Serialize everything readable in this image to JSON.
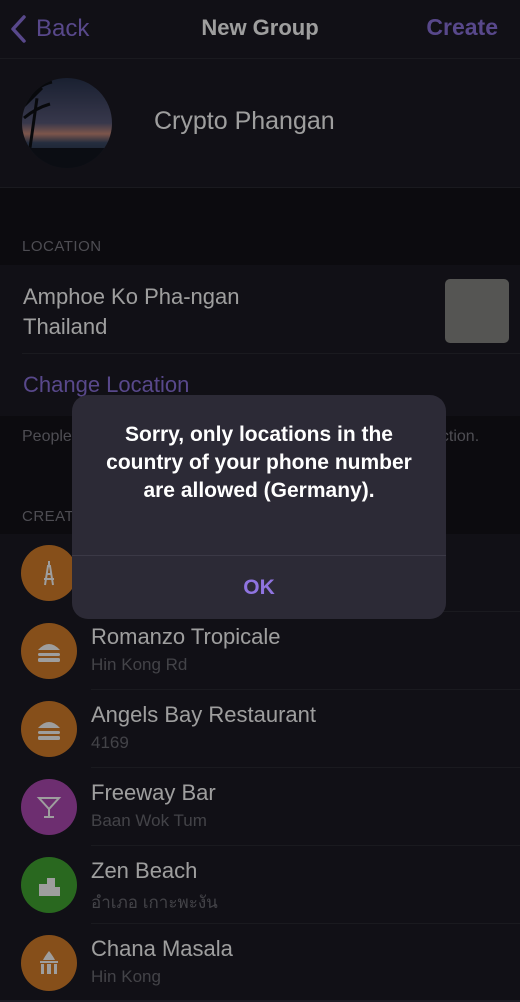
{
  "nav": {
    "back_label": "Back",
    "title": "New Group",
    "create_label": "Create"
  },
  "group": {
    "name": "Crypto Phangan"
  },
  "location": {
    "section_header": "LOCATION",
    "line1": "Amphoe Ko Pha-ngan",
    "line2": "Thailand",
    "change_label": "Change Location",
    "footer_visible_left": "People",
    "footer_visible_right": "ection."
  },
  "venues_section_header": "CREAT",
  "venues": [
    {
      "name": "",
      "address": "",
      "icon": "tower-icon",
      "color": "#d9802a"
    },
    {
      "name": "Romanzo Tropicale",
      "address": "Hin Kong Rd",
      "icon": "food-icon",
      "color": "#d9802a"
    },
    {
      "name": "Angels Bay Restaurant",
      "address": "4169",
      "icon": "food-icon",
      "color": "#d9802a"
    },
    {
      "name": "Freeway Bar",
      "address": "Baan Wok Tum",
      "icon": "cocktail-icon",
      "color": "#b04bb5"
    },
    {
      "name": "Zen Beach",
      "address": "อำเภอ เกาะพะงัน",
      "icon": "building-icon",
      "color": "#43a833"
    },
    {
      "name": "Chana Masala",
      "address": "Hin Kong",
      "icon": "temple-icon",
      "color": "#d9802a"
    }
  ],
  "alert": {
    "message": "Sorry, only locations in the country of your phone number are allowed (Germany).",
    "ok_label": "OK"
  },
  "colors": {
    "accent": "#8f74e0",
    "background": "#1c1b24",
    "section": "#141319"
  }
}
